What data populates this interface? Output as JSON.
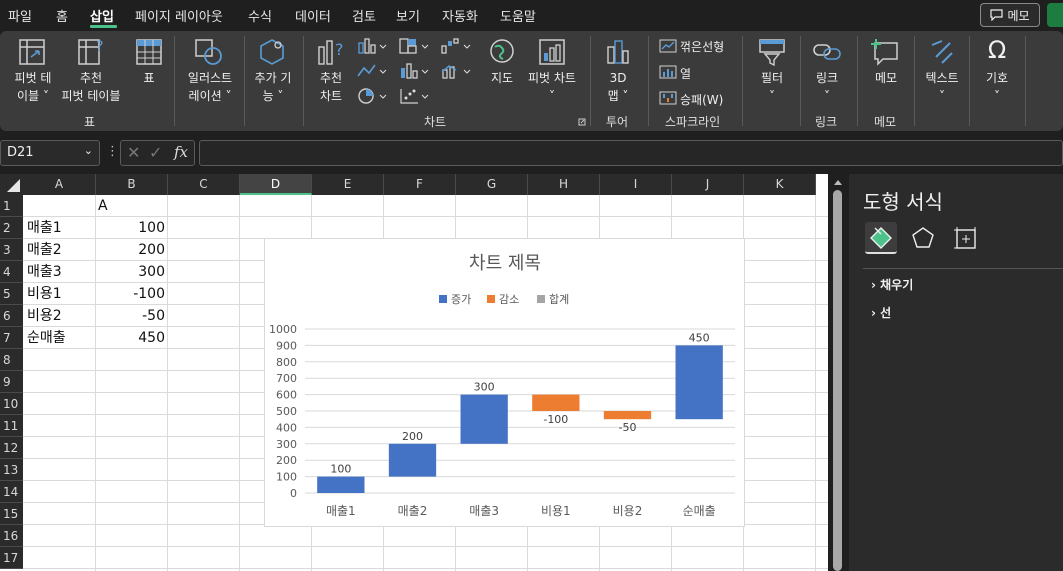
{
  "menu": {
    "tabs": [
      "파일",
      "홈",
      "삽입",
      "페이지 레이아웃",
      "수식",
      "데이터",
      "검토",
      "보기",
      "자동화",
      "도움말"
    ],
    "active_tab": "삽입",
    "memo_button": "메모"
  },
  "ribbon": {
    "pivot_table": [
      "피벗 테",
      "이블 ˅"
    ],
    "recommended_pivot": [
      "추천",
      "피벗 테이블"
    ],
    "table": "표",
    "illustrations": [
      "일러스트",
      "레이션 ˅"
    ],
    "addins": [
      "추가 기",
      "능 ˅"
    ],
    "recommended_charts": [
      "추천",
      "차트"
    ],
    "maps": "지도",
    "pivot_chart": "피벗 차트",
    "map3d": [
      "3D",
      "맵 ˅"
    ],
    "sparkline_line": "꺾은선형",
    "sparkline_column": "열",
    "sparkline_winloss": "승패(W)",
    "filter": "필터",
    "link": "링크",
    "comment": "메모",
    "text": "텍스트",
    "symbols": "기호",
    "groups": {
      "tables": "표",
      "charts": "차트",
      "tours": "투어",
      "sparklines": "스파크라인",
      "links": "링크",
      "comments": "메모"
    }
  },
  "formula_bar": {
    "name_box": "D21",
    "fx": "fx",
    "value": ""
  },
  "sheet": {
    "columns": [
      "A",
      "B",
      "C",
      "D",
      "E",
      "F",
      "G",
      "H",
      "I",
      "J",
      "K"
    ],
    "selected_column": "D",
    "rows": [
      "1",
      "2",
      "3",
      "4",
      "5",
      "6",
      "7",
      "8",
      "9",
      "10",
      "11",
      "12",
      "13",
      "14",
      "15",
      "16",
      "17"
    ],
    "header_b1": "A",
    "data": [
      {
        "label": "매출1",
        "value": "100"
      },
      {
        "label": "매출2",
        "value": "200"
      },
      {
        "label": "매출3",
        "value": "300"
      },
      {
        "label": "비용1",
        "value": "-100"
      },
      {
        "label": "비용2",
        "value": "-50"
      },
      {
        "label": "순매출",
        "value": "450"
      }
    ]
  },
  "chart_data": {
    "type": "bar",
    "subtype": "waterfall",
    "title": "차트 제목",
    "legend": [
      {
        "name": "증가",
        "color": "#4472c4"
      },
      {
        "name": "감소",
        "color": "#ed7d31"
      },
      {
        "name": "합계",
        "color": "#a5a5a5"
      }
    ],
    "legend_position": "top",
    "categories": [
      "매출1",
      "매출2",
      "매출3",
      "비용1",
      "비용2",
      "순매출"
    ],
    "values": [
      100,
      200,
      300,
      -100,
      -50,
      450
    ],
    "bars": [
      {
        "category": "매출1",
        "start": 0,
        "end": 100,
        "label": "100",
        "kind": "증가"
      },
      {
        "category": "매출2",
        "start": 100,
        "end": 300,
        "label": "200",
        "kind": "증가"
      },
      {
        "category": "매출3",
        "start": 300,
        "end": 600,
        "label": "300",
        "kind": "증가"
      },
      {
        "category": "비용1",
        "start": 600,
        "end": 500,
        "label": "-100",
        "kind": "감소"
      },
      {
        "category": "비용2",
        "start": 500,
        "end": 450,
        "label": "-50",
        "kind": "감소"
      },
      {
        "category": "순매출",
        "start": 450,
        "end": 900,
        "label": "450",
        "kind": "증가"
      }
    ],
    "yticks": [
      "0",
      "100",
      "200",
      "300",
      "400",
      "500",
      "600",
      "700",
      "800",
      "900",
      "1000"
    ],
    "ylim": [
      0,
      1000
    ],
    "grid": true
  },
  "pane": {
    "title": "도형 서식",
    "sections": [
      "채우기",
      "선"
    ],
    "tabs": [
      "fill-line-icon",
      "effects-icon",
      "size-properties-icon"
    ]
  },
  "colors": {
    "accent": "#4cc38a",
    "increase": "#4472c4",
    "decrease": "#ed7d31",
    "total": "#a5a5a5"
  }
}
